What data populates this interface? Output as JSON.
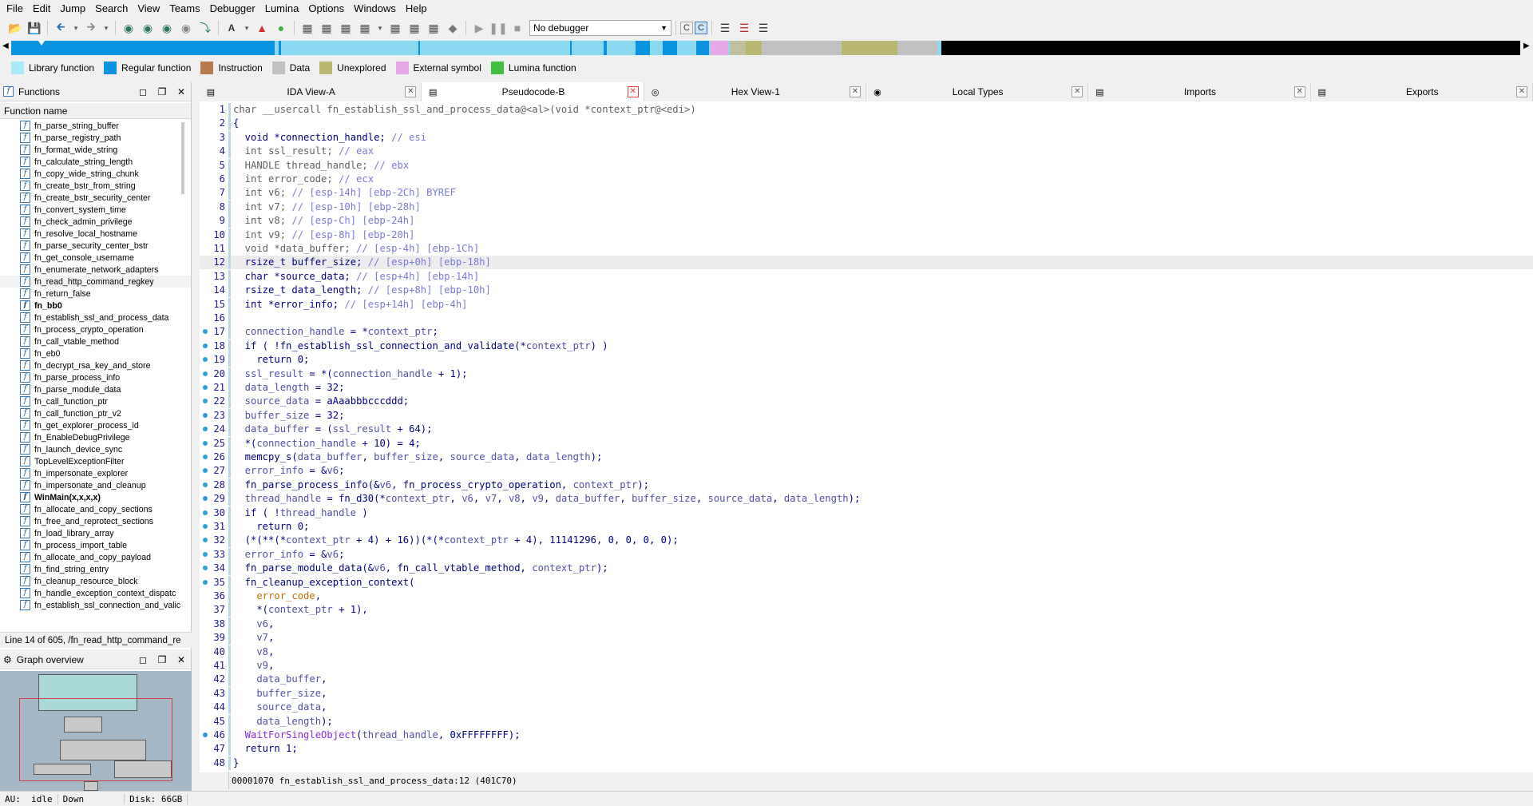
{
  "menu": [
    "File",
    "Edit",
    "Jump",
    "Search",
    "View",
    "Teams",
    "Debugger",
    "Lumina",
    "Options",
    "Windows",
    "Help"
  ],
  "toolbar": {
    "debugger_value": "No debugger"
  },
  "legend": [
    {
      "label": "Library function",
      "color": "#a8e8f8"
    },
    {
      "label": "Regular function",
      "color": "#0a94e0"
    },
    {
      "label": "Instruction",
      "color": "#b87850"
    },
    {
      "label": "Data",
      "color": "#c0c0c0"
    },
    {
      "label": "Unexplored",
      "color": "#b8b870"
    },
    {
      "label": "External symbol",
      "color": "#e8a8e8"
    },
    {
      "label": "Lumina function",
      "color": "#40c040"
    }
  ],
  "functions_panel": {
    "title": "Functions",
    "column_header": "Function name",
    "items": [
      "fn_parse_string_buffer",
      "fn_parse_registry_path",
      "fn_format_wide_string",
      "fn_calculate_string_length",
      "fn_copy_wide_string_chunk",
      "fn_create_bstr_from_string",
      "fn_create_bstr_security_center",
      "fn_convert_system_time",
      "fn_check_admin_privilege",
      "fn_resolve_local_hostname",
      "fn_parse_security_center_bstr",
      "fn_get_console_username",
      "fn_enumerate_network_adapters",
      "fn_read_http_command_regkey",
      "fn_return_false",
      "fn_bb0",
      "fn_establish_ssl_and_process_data",
      "fn_process_crypto_operation",
      "fn_call_vtable_method",
      "fn_eb0",
      "fn_decrypt_rsa_key_and_store",
      "fn_parse_process_info",
      "fn_parse_module_data",
      "fn_call_function_ptr",
      "fn_call_function_ptr_v2",
      "fn_get_explorer_process_id",
      "fn_EnableDebugPrivilege",
      "fn_launch_device_sync",
      "TopLevelExceptionFilter",
      "fn_impersonate_explorer",
      "fn_impersonate_and_cleanup",
      "WinMain(x,x,x,x)",
      "fn_allocate_and_copy_sections",
      "fn_free_and_reprotect_sections",
      "fn_load_library_array",
      "fn_process_import_table",
      "fn_allocate_and_copy_payload",
      "fn_find_string_entry",
      "fn_cleanup_resource_block",
      "fn_handle_exception_context_dispatc",
      "fn_establish_ssl_connection_and_valic"
    ],
    "bold_items": [
      "fn_bb0",
      "WinMain(x,x,x,x)"
    ],
    "selected_item": "fn_read_http_command_regkey",
    "status": "Line 14 of 605, /fn_read_http_command_re"
  },
  "graph_panel": {
    "title": "Graph overview"
  },
  "tabs": [
    {
      "label": "IDA View-A",
      "icon": "ida-view-icon",
      "active": false
    },
    {
      "label": "Pseudocode-B",
      "icon": "pseudocode-icon",
      "active": true
    },
    {
      "label": "Hex View-1",
      "icon": "hex-view-icon",
      "active": false
    },
    {
      "label": "Local Types",
      "icon": "local-types-icon",
      "active": false
    },
    {
      "label": "Imports",
      "icon": "imports-icon",
      "active": false
    },
    {
      "label": "Exports",
      "icon": "exports-icon",
      "active": false
    }
  ],
  "code": {
    "highlight_line": 12,
    "breakpoint_lines": [
      17,
      18,
      19,
      20,
      21,
      22,
      23,
      24,
      25,
      26,
      27,
      28,
      29,
      30,
      31,
      32,
      33,
      34,
      35,
      46
    ],
    "lines": [
      {
        "n": 1,
        "segs": [
          [
            "gray",
            "char __usercall fn_establish_ssl_and_process_data@<al>(void *context_ptr@<edi>)"
          ]
        ]
      },
      {
        "n": 2,
        "segs": [
          [
            "kw",
            "{"
          ]
        ]
      },
      {
        "n": 3,
        "segs": [
          [
            "kw",
            "  void *connection_handle; "
          ],
          [
            "cm",
            "// esi"
          ]
        ]
      },
      {
        "n": 4,
        "segs": [
          [
            "gray",
            "  int ssl_result; "
          ],
          [
            "cm",
            "// eax"
          ]
        ]
      },
      {
        "n": 5,
        "segs": [
          [
            "gray",
            "  HANDLE thread_handle; "
          ],
          [
            "cm",
            "// ebx"
          ]
        ]
      },
      {
        "n": 6,
        "segs": [
          [
            "gray",
            "  int error_code; "
          ],
          [
            "cm",
            "// ecx"
          ]
        ]
      },
      {
        "n": 7,
        "segs": [
          [
            "gray",
            "  int v6; "
          ],
          [
            "cm",
            "// [esp-14h] [ebp-2Ch] BYREF"
          ]
        ]
      },
      {
        "n": 8,
        "segs": [
          [
            "gray",
            "  int v7; "
          ],
          [
            "cm",
            "// [esp-10h] [ebp-28h]"
          ]
        ]
      },
      {
        "n": 9,
        "segs": [
          [
            "gray",
            "  int v8; "
          ],
          [
            "cm",
            "// [esp-Ch] [ebp-24h]"
          ]
        ]
      },
      {
        "n": 10,
        "segs": [
          [
            "gray",
            "  int v9; "
          ],
          [
            "cm",
            "// [esp-8h] [ebp-20h]"
          ]
        ]
      },
      {
        "n": 11,
        "segs": [
          [
            "gray",
            "  void *data_buffer; "
          ],
          [
            "cm",
            "// [esp-4h] [ebp-1Ch]"
          ]
        ]
      },
      {
        "n": 12,
        "segs": [
          [
            "kw",
            "  rsize_t buffer_size; "
          ],
          [
            "cm",
            "// [esp+0h] [ebp-18h]"
          ]
        ]
      },
      {
        "n": 13,
        "segs": [
          [
            "kw",
            "  char *source_data; "
          ],
          [
            "cm",
            "// [esp+4h] [ebp-14h]"
          ]
        ]
      },
      {
        "n": 14,
        "segs": [
          [
            "kw",
            "  rsize_t data_length; "
          ],
          [
            "cm",
            "// [esp+8h] [ebp-10h]"
          ]
        ]
      },
      {
        "n": 15,
        "segs": [
          [
            "kw",
            "  int *error_info; "
          ],
          [
            "cm",
            "// [esp+14h] [ebp-4h]"
          ]
        ]
      },
      {
        "n": 16,
        "segs": [
          [
            "kw",
            ""
          ]
        ]
      },
      {
        "n": 17,
        "segs": [
          [
            "var",
            "  connection_handle"
          ],
          [
            "kw",
            " = *"
          ],
          [
            "var",
            "context_ptr"
          ],
          [
            "kw",
            ";"
          ]
        ]
      },
      {
        "n": 18,
        "segs": [
          [
            "kw",
            "  if ( !fn_establish_ssl_connection_and_validate(*"
          ],
          [
            "var",
            "context_ptr"
          ],
          [
            "kw",
            ") )"
          ]
        ]
      },
      {
        "n": 19,
        "segs": [
          [
            "kw",
            "    return 0;"
          ]
        ]
      },
      {
        "n": 20,
        "segs": [
          [
            "var",
            "  ssl_result"
          ],
          [
            "kw",
            " = *("
          ],
          [
            "var",
            "connection_handle"
          ],
          [
            "kw",
            " + 1);"
          ]
        ]
      },
      {
        "n": 21,
        "segs": [
          [
            "var",
            "  data_length"
          ],
          [
            "kw",
            " = 32;"
          ]
        ]
      },
      {
        "n": 22,
        "segs": [
          [
            "var",
            "  source_data"
          ],
          [
            "kw",
            " = aAaabbbcccddd;"
          ]
        ]
      },
      {
        "n": 23,
        "segs": [
          [
            "var",
            "  buffer_size"
          ],
          [
            "kw",
            " = 32;"
          ]
        ]
      },
      {
        "n": 24,
        "segs": [
          [
            "var",
            "  data_buffer"
          ],
          [
            "kw",
            " = ("
          ],
          [
            "var",
            "ssl_result"
          ],
          [
            "kw",
            " + 64);"
          ]
        ]
      },
      {
        "n": 25,
        "segs": [
          [
            "kw",
            "  *("
          ],
          [
            "var",
            "connection_handle"
          ],
          [
            "kw",
            " + 10) = 4;"
          ]
        ]
      },
      {
        "n": 26,
        "segs": [
          [
            "kw",
            "  memcpy_s("
          ],
          [
            "var",
            "data_buffer"
          ],
          [
            "kw",
            ", "
          ],
          [
            "var",
            "buffer_size"
          ],
          [
            "kw",
            ", "
          ],
          [
            "var",
            "source_data"
          ],
          [
            "kw",
            ", "
          ],
          [
            "var",
            "data_length"
          ],
          [
            "kw",
            ");"
          ]
        ]
      },
      {
        "n": 27,
        "segs": [
          [
            "var",
            "  error_info"
          ],
          [
            "kw",
            " = &"
          ],
          [
            "var",
            "v6"
          ],
          [
            "kw",
            ";"
          ]
        ]
      },
      {
        "n": 28,
        "segs": [
          [
            "kw",
            "  fn_parse_process_info(&"
          ],
          [
            "var",
            "v6"
          ],
          [
            "kw",
            ", fn_process_crypto_operation, "
          ],
          [
            "var",
            "context_ptr"
          ],
          [
            "kw",
            ");"
          ]
        ]
      },
      {
        "n": 29,
        "segs": [
          [
            "var",
            "  thread_handle"
          ],
          [
            "kw",
            " = fn_d30(*"
          ],
          [
            "var",
            "context_ptr"
          ],
          [
            "kw",
            ", "
          ],
          [
            "var",
            "v6"
          ],
          [
            "kw",
            ", "
          ],
          [
            "var",
            "v7"
          ],
          [
            "kw",
            ", "
          ],
          [
            "var",
            "v8"
          ],
          [
            "kw",
            ", "
          ],
          [
            "var",
            "v9"
          ],
          [
            "kw",
            ", "
          ],
          [
            "var",
            "data_buffer"
          ],
          [
            "kw",
            ", "
          ],
          [
            "var",
            "buffer_size"
          ],
          [
            "kw",
            ", "
          ],
          [
            "var",
            "source_data"
          ],
          [
            "kw",
            ", "
          ],
          [
            "var",
            "data_length"
          ],
          [
            "kw",
            ");"
          ]
        ]
      },
      {
        "n": 30,
        "segs": [
          [
            "kw",
            "  if ( !"
          ],
          [
            "var",
            "thread_handle"
          ],
          [
            "kw",
            " )"
          ]
        ]
      },
      {
        "n": 31,
        "segs": [
          [
            "kw",
            "    return 0;"
          ]
        ]
      },
      {
        "n": 32,
        "segs": [
          [
            "kw",
            "  (*(**(*"
          ],
          [
            "var",
            "context_ptr"
          ],
          [
            "kw",
            " + 4) + 16))(*(*"
          ],
          [
            "var",
            "context_ptr"
          ],
          [
            "kw",
            " + 4), 11141296, 0, 0, 0, 0);"
          ]
        ]
      },
      {
        "n": 33,
        "segs": [
          [
            "var",
            "  error_info"
          ],
          [
            "kw",
            " = &"
          ],
          [
            "var",
            "v6"
          ],
          [
            "kw",
            ";"
          ]
        ]
      },
      {
        "n": 34,
        "segs": [
          [
            "kw",
            "  fn_parse_module_data(&"
          ],
          [
            "var",
            "v6"
          ],
          [
            "kw",
            ", fn_call_vtable_method, "
          ],
          [
            "var",
            "context_ptr"
          ],
          [
            "kw",
            ");"
          ]
        ]
      },
      {
        "n": 35,
        "segs": [
          [
            "kw",
            "  fn_cleanup_exception_context("
          ]
        ]
      },
      {
        "n": 36,
        "segs": [
          [
            "err",
            "    error_code"
          ],
          [
            "kw",
            ","
          ]
        ]
      },
      {
        "n": 37,
        "segs": [
          [
            "kw",
            "    *("
          ],
          [
            "var",
            "context_ptr"
          ],
          [
            "kw",
            " + 1),"
          ]
        ]
      },
      {
        "n": 38,
        "segs": [
          [
            "var",
            "    v6"
          ],
          [
            "kw",
            ","
          ]
        ]
      },
      {
        "n": 39,
        "segs": [
          [
            "var",
            "    v7"
          ],
          [
            "kw",
            ","
          ]
        ]
      },
      {
        "n": 40,
        "segs": [
          [
            "var",
            "    v8"
          ],
          [
            "kw",
            ","
          ]
        ]
      },
      {
        "n": 41,
        "segs": [
          [
            "var",
            "    v9"
          ],
          [
            "kw",
            ","
          ]
        ]
      },
      {
        "n": 42,
        "segs": [
          [
            "var",
            "    data_buffer"
          ],
          [
            "kw",
            ","
          ]
        ]
      },
      {
        "n": 43,
        "segs": [
          [
            "var",
            "    buffer_size"
          ],
          [
            "kw",
            ","
          ]
        ]
      },
      {
        "n": 44,
        "segs": [
          [
            "var",
            "    source_data"
          ],
          [
            "kw",
            ","
          ]
        ]
      },
      {
        "n": 45,
        "segs": [
          [
            "var",
            "    data_length"
          ],
          [
            "kw",
            ");"
          ]
        ]
      },
      {
        "n": 46,
        "segs": [
          [
            "mag",
            "  WaitForSingleObject"
          ],
          [
            "kw",
            "("
          ],
          [
            "var",
            "thread_handle"
          ],
          [
            "kw",
            ", 0xFFFFFFFF);"
          ]
        ]
      },
      {
        "n": 47,
        "segs": [
          [
            "kw",
            "  return 1;"
          ]
        ]
      },
      {
        "n": 48,
        "segs": [
          [
            "kw",
            "}"
          ]
        ]
      }
    ],
    "status": "00001070 fn_establish_ssl_and_process_data:12 (401C70)"
  },
  "statusbar": {
    "au": "AU:  idle",
    "direction": "Down",
    "disk": "Disk: 66GB"
  }
}
